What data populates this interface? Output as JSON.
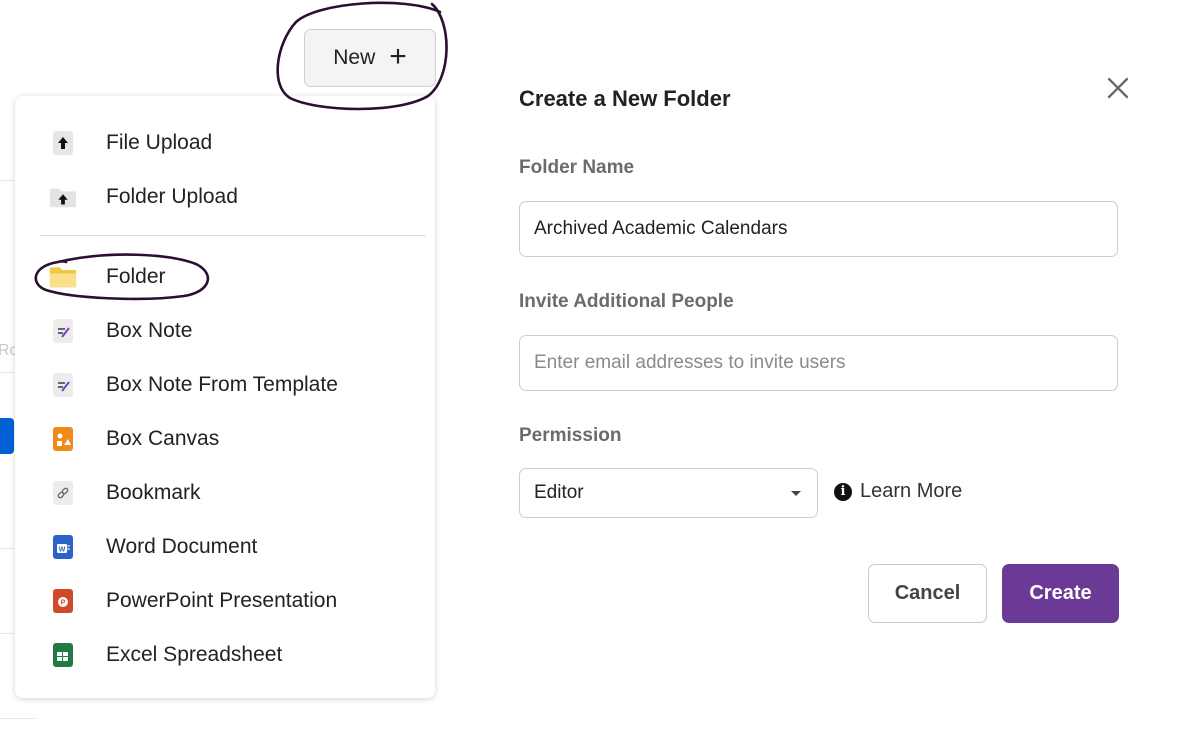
{
  "new_button": {
    "label": "New",
    "plus": "+"
  },
  "menu": {
    "upload_items": [
      {
        "label": "File Upload",
        "icon": "upload-arrow-icon"
      },
      {
        "label": "Folder Upload",
        "icon": "folder-upload-icon"
      }
    ],
    "create_items": [
      {
        "label": "Folder",
        "icon": "folder-icon"
      },
      {
        "label": "Box Note",
        "icon": "box-note-icon"
      },
      {
        "label": "Box Note From Template",
        "icon": "box-note-template-icon"
      },
      {
        "label": "Box Canvas",
        "icon": "box-canvas-icon"
      },
      {
        "label": "Bookmark",
        "icon": "bookmark-link-icon"
      },
      {
        "label": "Word Document",
        "icon": "word-icon"
      },
      {
        "label": "PowerPoint Presentation",
        "icon": "powerpoint-icon"
      },
      {
        "label": "Excel Spreadsheet",
        "icon": "excel-icon"
      }
    ]
  },
  "dialog": {
    "title": "Create a New Folder",
    "folder_name_label": "Folder Name",
    "folder_name_value": "Archived Academic Calendars",
    "invite_label": "Invite Additional People",
    "invite_placeholder": "Enter email addresses to invite users",
    "permission_label": "Permission",
    "permission_value": "Editor",
    "learn_more": "Learn More",
    "cancel_label": "Cancel",
    "create_label": "Create"
  },
  "background": {
    "partial_text": "Rc"
  },
  "colors": {
    "create_button": "#6b3a96",
    "annotation_ink": "#2a0f33",
    "folder_yellow": "#f7d774",
    "word_blue": "#2b63c9",
    "powerpoint_red": "#d0492b",
    "excel_green": "#1f7a43",
    "canvas_orange": "#f08a1c"
  }
}
